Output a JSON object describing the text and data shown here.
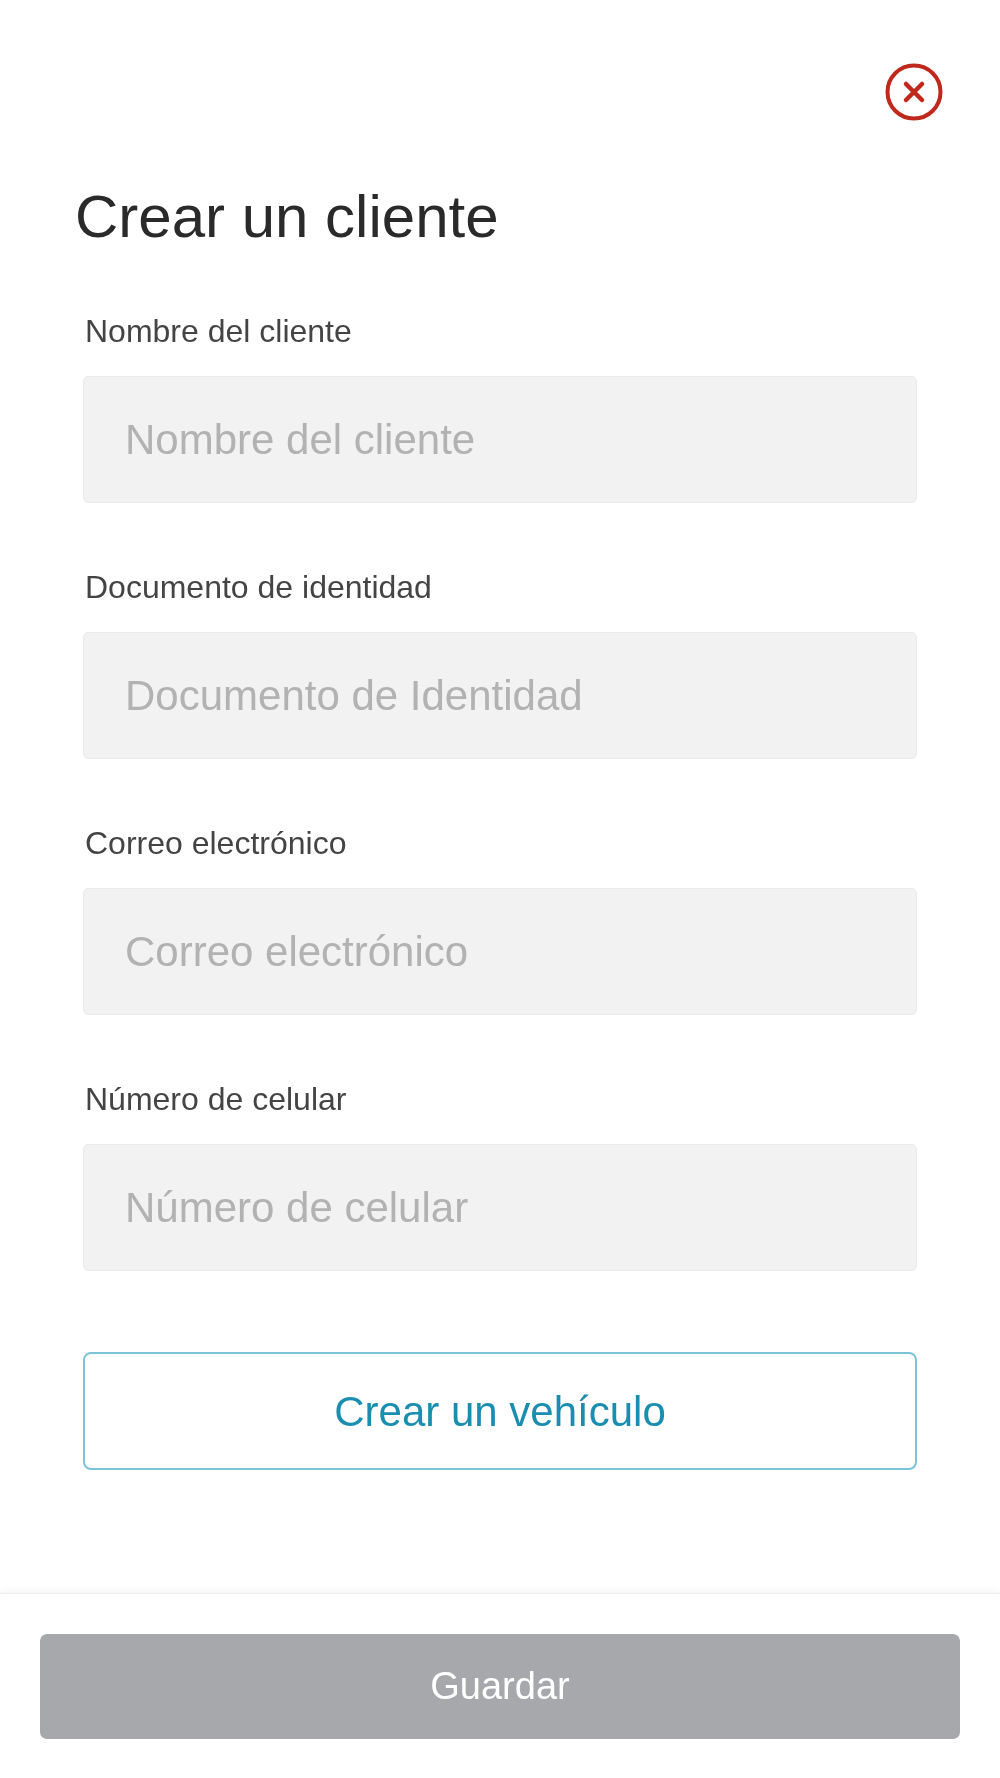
{
  "title": "Crear un cliente",
  "fields": [
    {
      "label": "Nombre del cliente",
      "placeholder": "Nombre del cliente"
    },
    {
      "label": "Documento de identidad",
      "placeholder": "Documento de Identidad"
    },
    {
      "label": "Correo electrónico",
      "placeholder": "Correo electrónico"
    },
    {
      "label": "Número de celular",
      "placeholder": "Número de celular"
    }
  ],
  "secondary_button": {
    "label": "Crear un vehículo"
  },
  "footer": {
    "save_button": {
      "label": "Guardar",
      "disabled": true
    }
  }
}
